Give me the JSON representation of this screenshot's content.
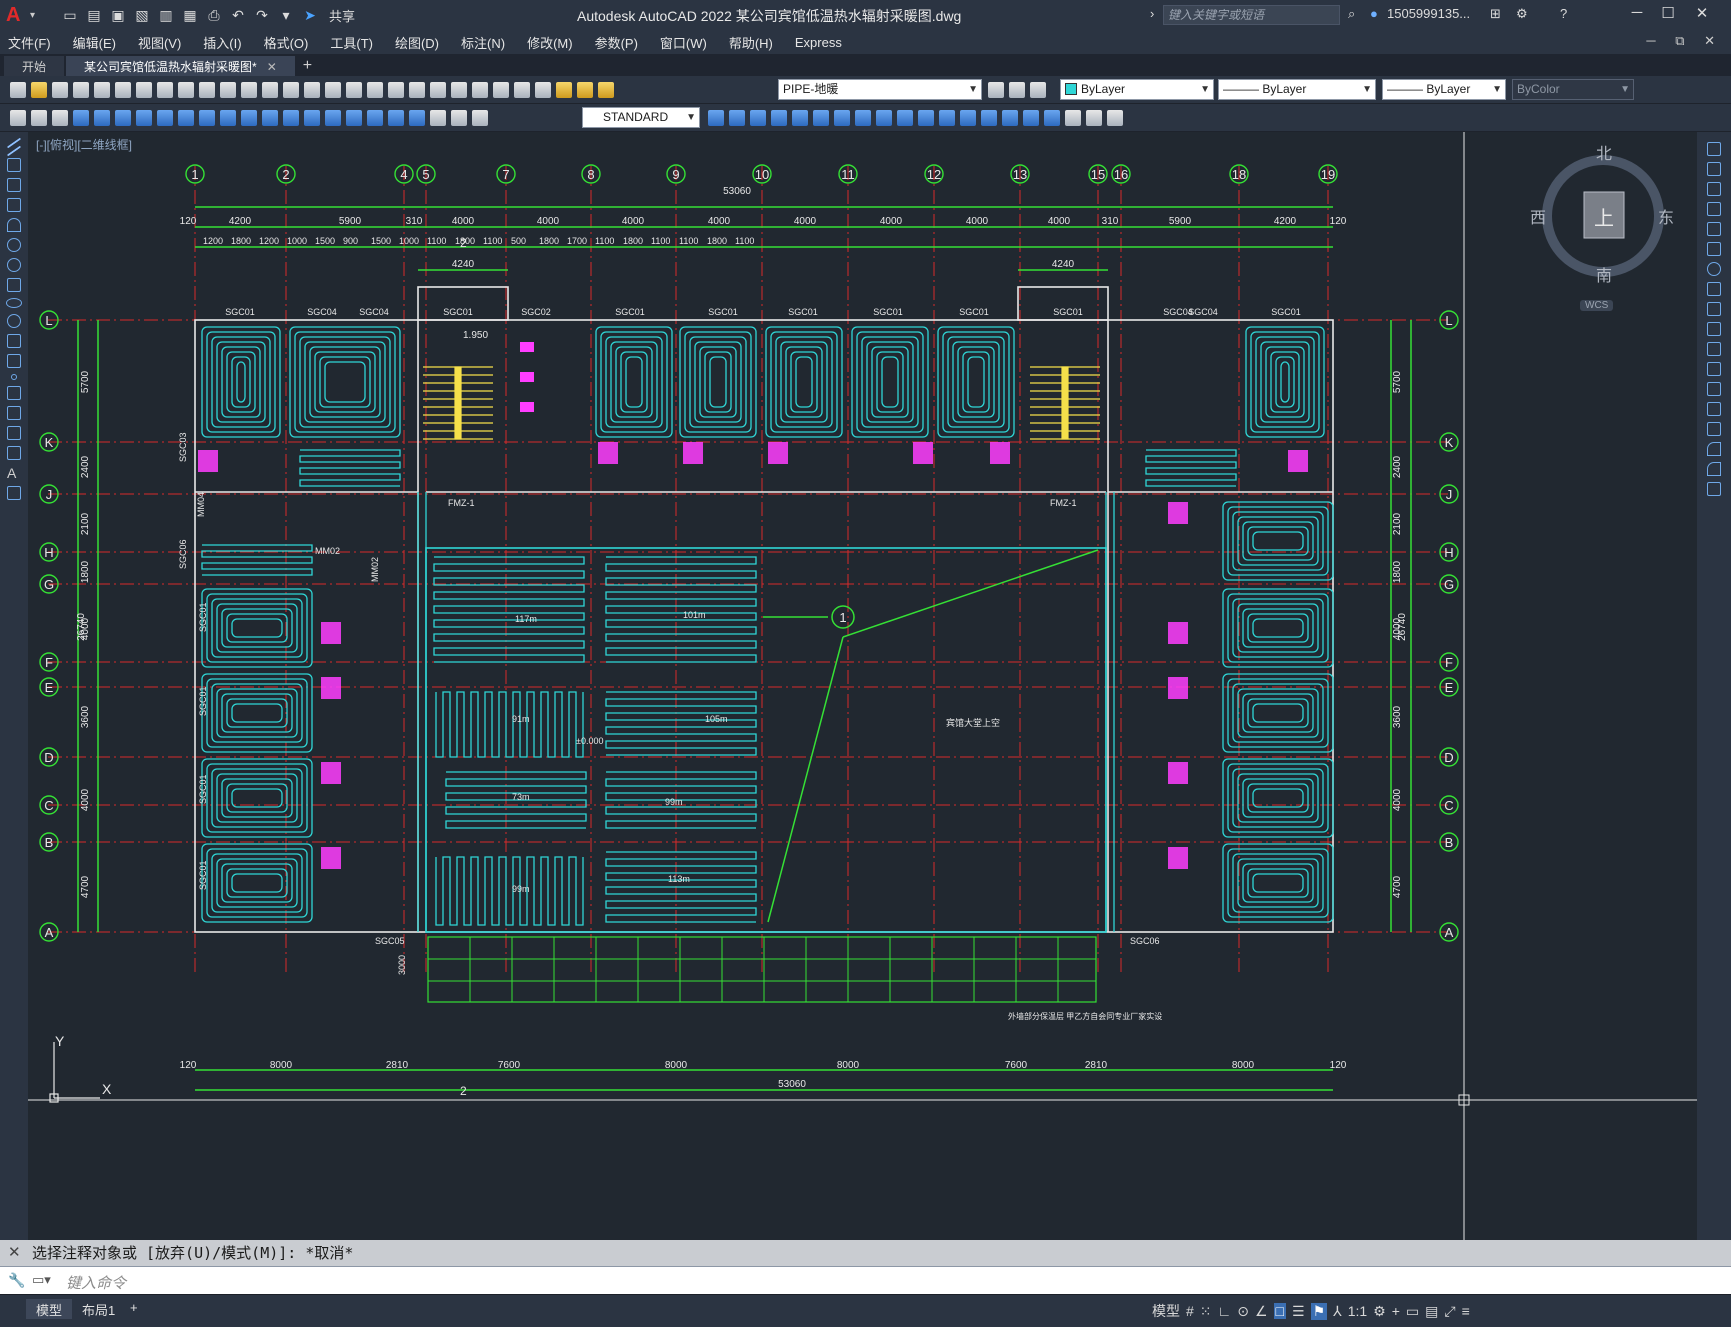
{
  "app": {
    "title": "Autodesk AutoCAD 2022    某公司宾馆低温热水辐射采暖图.dwg",
    "share": "共享",
    "search_placeholder": "键入关键字或短语",
    "user": "1505999135...",
    "logo": "A"
  },
  "menu": [
    "文件(F)",
    "编辑(E)",
    "视图(V)",
    "插入(I)",
    "格式(O)",
    "工具(T)",
    "绘图(D)",
    "标注(N)",
    "修改(M)",
    "参数(P)",
    "窗口(W)",
    "帮助(H)",
    "Express"
  ],
  "tabs": [
    {
      "label": "开始",
      "active": false
    },
    {
      "label": "某公司宾馆低温热水辐射采暖图*",
      "active": true,
      "close": "✕"
    }
  ],
  "toolbar": {
    "layer": "PIPE-地暖",
    "color": "ByLayer",
    "linetype": "——— ByLayer",
    "lineweight": "——— ByLayer",
    "plotstyle": "ByColor",
    "textstyle": "STANDARD"
  },
  "viewport": {
    "label": "[-][俯视][二维线框]",
    "ucs_y": "Y",
    "ucs_x": "X"
  },
  "viewcube": {
    "north": "北",
    "south": "南",
    "east": "东",
    "west": "西",
    "top": "上",
    "wcs": "WCS"
  },
  "drawing": {
    "axis_numbers": [
      "1",
      "2",
      "4",
      "5",
      "7",
      "8",
      "9",
      "10",
      "11",
      "12",
      "13",
      "15",
      "16",
      "18",
      "19"
    ],
    "axis_letters": [
      "L",
      "K",
      "J",
      "H",
      "G",
      "F",
      "E",
      "D",
      "C",
      "B",
      "A"
    ],
    "overall_dim": "53060",
    "top_dims": [
      "120",
      "4200",
      "5900",
      "310",
      "4000",
      "4000",
      "4000",
      "4000",
      "4000",
      "4000",
      "4000",
      "4000",
      "310",
      "5900",
      "4200",
      "120"
    ],
    "top_sub_dims": [
      "1200",
      "1800",
      "1200",
      "1000",
      "1500",
      "900",
      "1500",
      "1000",
      "1100",
      "1800",
      "1100",
      "500",
      "1800",
      "1700",
      "1100",
      "1800",
      "1100",
      "1100",
      "1800",
      "1100"
    ],
    "stair_dim_left": "4240",
    "stair_dim_right": "4240",
    "bottom_dims": [
      "120",
      "8000",
      "2810",
      "7600",
      "8000",
      "8000",
      "7600",
      "2810",
      "8000",
      "120"
    ],
    "height_dims": [
      "5700",
      "2400",
      "2100",
      "1800",
      "4000",
      "3600",
      "4000",
      "4700"
    ],
    "total_height": "26740",
    "callout": "2",
    "unit_labels": [
      "SGC01",
      "SGC04",
      "SGC04",
      "SGC01",
      "SGC02",
      "SGC01",
      "SGC01",
      "SGC01",
      "SGC01",
      "SGC01",
      "SGC01",
      "SGC04",
      "SGC04",
      "SGC01"
    ],
    "side_labels": [
      "SGC03",
      "MM04",
      "SGC06",
      "SGC01",
      "SGC01",
      "SGC01",
      "SGC01",
      "SGC05",
      "SGC06"
    ],
    "door_labels": [
      "FMZ-1",
      "FMZ-1",
      "MM02",
      "MM02"
    ],
    "room_areas": [
      "117m",
      "101m",
      "91m",
      "105m",
      "73m",
      "99m",
      "99m",
      "113m"
    ],
    "elevation": "±0.000",
    "hall_label": "宾馆大堂上空",
    "stair_elev": "1.950",
    "section_bubble": "1",
    "bottom_height": "3000",
    "note": "外墙部分保温层 甲乙方自会同专业厂家实设"
  },
  "command": {
    "history": "选择注释对象或 [放弃(U)/模式(M)]: *取消*",
    "placeholder": "键入命令"
  },
  "status": {
    "tabs": [
      {
        "label": "模型",
        "active": true
      },
      {
        "label": "布局1",
        "active": false
      }
    ],
    "add": "+",
    "model": "模型",
    "scale": "1:1"
  },
  "colors": {
    "pipe": "#2fd6d6",
    "axis": "#d62a2a",
    "dim": "#35e035",
    "wall": "#e8e8e8",
    "sanitary": "#ff3dff",
    "stair": "#f5e04a"
  }
}
